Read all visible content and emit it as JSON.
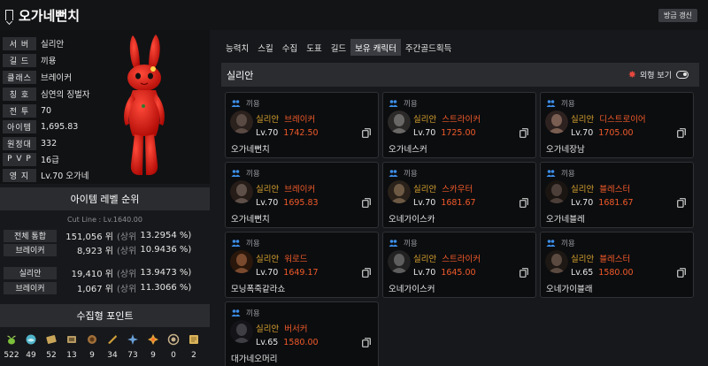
{
  "header": {
    "character_name": "오가네뻔치",
    "update_button": "방금 갱신"
  },
  "profile": {
    "rows": [
      {
        "label": "서 버",
        "value": "실리안"
      },
      {
        "label": "길 드",
        "value": "끼용"
      },
      {
        "label": "클래스",
        "value": "브레이커"
      },
      {
        "label": "칭 호",
        "value": "심연의 징벌자"
      },
      {
        "label": "전 투",
        "value": "70"
      },
      {
        "label": "아이템",
        "value": "1,695.83"
      },
      {
        "label": "원정대",
        "value": "332"
      },
      {
        "label": "P V P",
        "value": "16급"
      },
      {
        "label": "영 지",
        "value": "Lv.70 오가네"
      }
    ]
  },
  "item_rank": {
    "title": "아이템 레벨 순위",
    "cutline": "Cut Line : Lv.1640.00",
    "rows": [
      {
        "label": "전체 통합",
        "rank": "151,056 위",
        "sub": "(상위",
        "pct": "13.2954 %)"
      },
      {
        "label": "브레이커",
        "rank": "8,923 위",
        "sub": "(상위",
        "pct": "10.9436 %)"
      },
      {
        "label": "실리안",
        "rank": "19,410 위",
        "sub": "(상위",
        "pct": "13.9473 %)"
      },
      {
        "label": "브레이커",
        "rank": "1,067 위",
        "sub": "(상위",
        "pct": "11.3066 %)"
      }
    ]
  },
  "collect": {
    "title": "수집형 포인트",
    "items": [
      {
        "icon": "mokoko-seed-icon",
        "count": "522",
        "color": "#7bbf3a"
      },
      {
        "icon": "island-heart-icon",
        "count": "49",
        "color": "#4fb3c9"
      },
      {
        "icon": "giant-heart-icon",
        "count": "52",
        "color": "#c9a55a"
      },
      {
        "icon": "masterpiece-icon",
        "count": "13",
        "color": "#b79a63"
      },
      {
        "icon": "ignea-token-icon",
        "count": "9",
        "color": "#a0703a"
      },
      {
        "icon": "adventure-book-icon",
        "count": "34",
        "color": "#d4a23a"
      },
      {
        "icon": "sea-bounty-icon",
        "count": "73",
        "color": "#6aa0d8"
      },
      {
        "icon": "world-tree-leaf-icon",
        "count": "9",
        "color": "#e0a43a"
      },
      {
        "icon": "orpheus-star-icon",
        "count": "0",
        "color": "#c7b08a"
      },
      {
        "icon": "omnium-star-icon",
        "count": "2",
        "color": "#d9b35a"
      }
    ]
  },
  "tabs": [
    "능력치",
    "스킬",
    "수집",
    "도표",
    "길드",
    "보유 캐릭터",
    "주간골드획득"
  ],
  "active_tab": 5,
  "roster": {
    "server": "실리안",
    "appearance_label": "외형 보기",
    "characters": [
      {
        "guild": "끼용",
        "server": "실리안",
        "class": "브레이커",
        "level": "Lv.70",
        "ilvl": "1742.50",
        "name": "오가네뻔치"
      },
      {
        "guild": "끼용",
        "server": "실리안",
        "class": "스트라이커",
        "level": "Lv.70",
        "ilvl": "1725.00",
        "name": "오가네스커"
      },
      {
        "guild": "끼용",
        "server": "실리안",
        "class": "디스트로이어",
        "level": "Lv.70",
        "ilvl": "1705.00",
        "name": "오가네장남"
      },
      {
        "guild": "끼용",
        "server": "실리안",
        "class": "브레이커",
        "level": "Lv.70",
        "ilvl": "1695.83",
        "name": "오가네뻔치"
      },
      {
        "guild": "끼용",
        "server": "실리안",
        "class": "스카우터",
        "level": "Lv.70",
        "ilvl": "1681.67",
        "name": "오네가이스카"
      },
      {
        "guild": "끼용",
        "server": "실리안",
        "class": "블레스터",
        "level": "Lv.70",
        "ilvl": "1681.67",
        "name": "오가네블레"
      },
      {
        "guild": "끼용",
        "server": "실리안",
        "class": "워로드",
        "level": "Lv.70",
        "ilvl": "1649.17",
        "name": "모닝폭죽같라쇼"
      },
      {
        "guild": "끼용",
        "server": "실리안",
        "class": "스트라이커",
        "level": "Lv.70",
        "ilvl": "1645.00",
        "name": "오네가이스커"
      },
      {
        "guild": "끼용",
        "server": "실리안",
        "class": "블레스터",
        "level": "Lv.65",
        "ilvl": "1580.00",
        "name": "오네가이블래"
      },
      {
        "guild": "끼용",
        "server": "실리안",
        "class": "버서커",
        "level": "Lv.65",
        "ilvl": "1580.00",
        "name": "대가네오머리"
      }
    ]
  }
}
